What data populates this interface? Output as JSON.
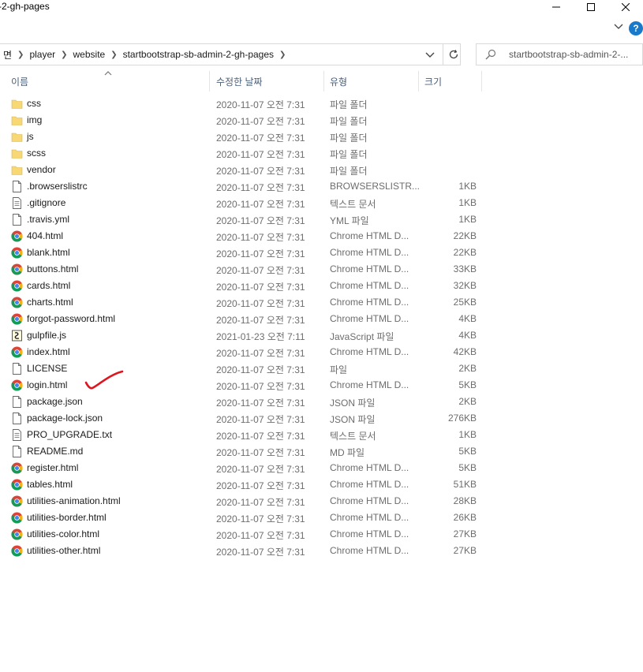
{
  "window": {
    "title": "-2-gh-pages"
  },
  "address": {
    "breadcrumbs": [
      "면",
      "player",
      "website",
      "startbootstrap-sb-admin-2-gh-pages"
    ]
  },
  "search": {
    "placeholder": "startbootstrap-sb-admin-2-..."
  },
  "columns": {
    "name": "이름",
    "date": "수정한 날짜",
    "type": "유형",
    "size": "크기"
  },
  "files": [
    {
      "name": "css",
      "date": "2020-11-07 오전 7:31",
      "type": "파일 폴더",
      "size": "",
      "icon": "folder"
    },
    {
      "name": "img",
      "date": "2020-11-07 오전 7:31",
      "type": "파일 폴더",
      "size": "",
      "icon": "folder"
    },
    {
      "name": "js",
      "date": "2020-11-07 오전 7:31",
      "type": "파일 폴더",
      "size": "",
      "icon": "folder"
    },
    {
      "name": "scss",
      "date": "2020-11-07 오전 7:31",
      "type": "파일 폴더",
      "size": "",
      "icon": "folder"
    },
    {
      "name": "vendor",
      "date": "2020-11-07 오전 7:31",
      "type": "파일 폴더",
      "size": "",
      "icon": "folder"
    },
    {
      "name": ".browserslistrc",
      "date": "2020-11-07 오전 7:31",
      "type": "BROWSERSLISTR...",
      "size": "1KB",
      "icon": "file"
    },
    {
      "name": ".gitignore",
      "date": "2020-11-07 오전 7:31",
      "type": "텍스트 문서",
      "size": "1KB",
      "icon": "text"
    },
    {
      "name": ".travis.yml",
      "date": "2020-11-07 오전 7:31",
      "type": "YML 파일",
      "size": "1KB",
      "icon": "file"
    },
    {
      "name": "404.html",
      "date": "2020-11-07 오전 7:31",
      "type": "Chrome HTML D...",
      "size": "22KB",
      "icon": "chrome"
    },
    {
      "name": "blank.html",
      "date": "2020-11-07 오전 7:31",
      "type": "Chrome HTML D...",
      "size": "22KB",
      "icon": "chrome"
    },
    {
      "name": "buttons.html",
      "date": "2020-11-07 오전 7:31",
      "type": "Chrome HTML D...",
      "size": "33KB",
      "icon": "chrome"
    },
    {
      "name": "cards.html",
      "date": "2020-11-07 오전 7:31",
      "type": "Chrome HTML D...",
      "size": "32KB",
      "icon": "chrome"
    },
    {
      "name": "charts.html",
      "date": "2020-11-07 오전 7:31",
      "type": "Chrome HTML D...",
      "size": "25KB",
      "icon": "chrome"
    },
    {
      "name": "forgot-password.html",
      "date": "2020-11-07 오전 7:31",
      "type": "Chrome HTML D...",
      "size": "4KB",
      "icon": "chrome"
    },
    {
      "name": "gulpfile.js",
      "date": "2021-01-23 오전 7:11",
      "type": "JavaScript 파일",
      "size": "4KB",
      "icon": "script"
    },
    {
      "name": "index.html",
      "date": "2020-11-07 오전 7:31",
      "type": "Chrome HTML D...",
      "size": "42KB",
      "icon": "chrome"
    },
    {
      "name": "LICENSE",
      "date": "2020-11-07 오전 7:31",
      "type": "파일",
      "size": "2KB",
      "icon": "file"
    },
    {
      "name": "login.html",
      "date": "2020-11-07 오전 7:31",
      "type": "Chrome HTML D...",
      "size": "5KB",
      "icon": "chrome"
    },
    {
      "name": "package.json",
      "date": "2020-11-07 오전 7:31",
      "type": "JSON 파일",
      "size": "2KB",
      "icon": "file"
    },
    {
      "name": "package-lock.json",
      "date": "2020-11-07 오전 7:31",
      "type": "JSON 파일",
      "size": "276KB",
      "icon": "file"
    },
    {
      "name": "PRO_UPGRADE.txt",
      "date": "2020-11-07 오전 7:31",
      "type": "텍스트 문서",
      "size": "1KB",
      "icon": "text"
    },
    {
      "name": "README.md",
      "date": "2020-11-07 오전 7:31",
      "type": "MD 파일",
      "size": "5KB",
      "icon": "file"
    },
    {
      "name": "register.html",
      "date": "2020-11-07 오전 7:31",
      "type": "Chrome HTML D...",
      "size": "5KB",
      "icon": "chrome"
    },
    {
      "name": "tables.html",
      "date": "2020-11-07 오전 7:31",
      "type": "Chrome HTML D...",
      "size": "51KB",
      "icon": "chrome"
    },
    {
      "name": "utilities-animation.html",
      "date": "2020-11-07 오전 7:31",
      "type": "Chrome HTML D...",
      "size": "28KB",
      "icon": "chrome"
    },
    {
      "name": "utilities-border.html",
      "date": "2020-11-07 오전 7:31",
      "type": "Chrome HTML D...",
      "size": "26KB",
      "icon": "chrome"
    },
    {
      "name": "utilities-color.html",
      "date": "2020-11-07 오전 7:31",
      "type": "Chrome HTML D...",
      "size": "27KB",
      "icon": "chrome"
    },
    {
      "name": "utilities-other.html",
      "date": "2020-11-07 오전 7:31",
      "type": "Chrome HTML D...",
      "size": "27KB",
      "icon": "chrome"
    }
  ],
  "colors": {
    "folder": "#f8d775",
    "accent": "#1979ca",
    "annotation": "#e0141e"
  },
  "icons": [
    "minimize-icon",
    "maximize-icon",
    "close-icon",
    "chevron-down-icon",
    "help-icon",
    "refresh-icon",
    "search-icon",
    "folder-icon",
    "file-icon",
    "text-file-icon",
    "chrome-icon",
    "script-icon"
  ]
}
